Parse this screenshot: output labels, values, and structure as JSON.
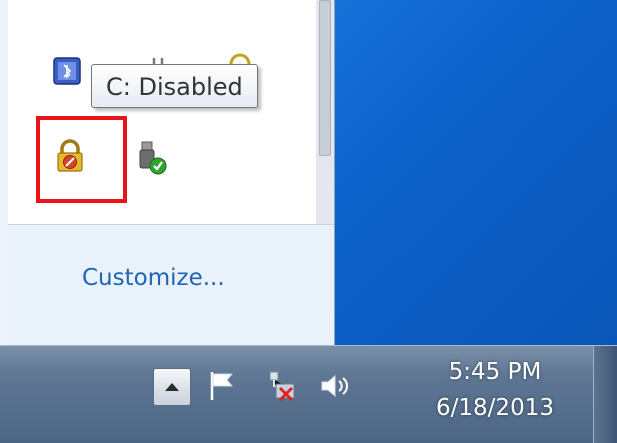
{
  "tooltip": {
    "text": "C: Disabled"
  },
  "overflow_popup": {
    "customize_label": "Customize...",
    "icons": [
      {
        "name": "bluetooth-adapter-icon"
      },
      {
        "name": "power-plug-icon"
      },
      {
        "name": "security-badge-icon"
      },
      {
        "name": "drive-lock-disabled-icon"
      },
      {
        "name": "safely-remove-hardware-icon"
      }
    ]
  },
  "taskbar": {
    "tray_icons": [
      "show-hidden-icons-icon",
      "action-center-flag-icon",
      "network-disconnected-icon",
      "volume-icon"
    ],
    "clock": {
      "time": "5:45 PM",
      "date": "6/18/2013"
    }
  },
  "colors": {
    "highlight": "#e8131b",
    "link": "#1f64b5",
    "desktop": "#0d63cc"
  }
}
